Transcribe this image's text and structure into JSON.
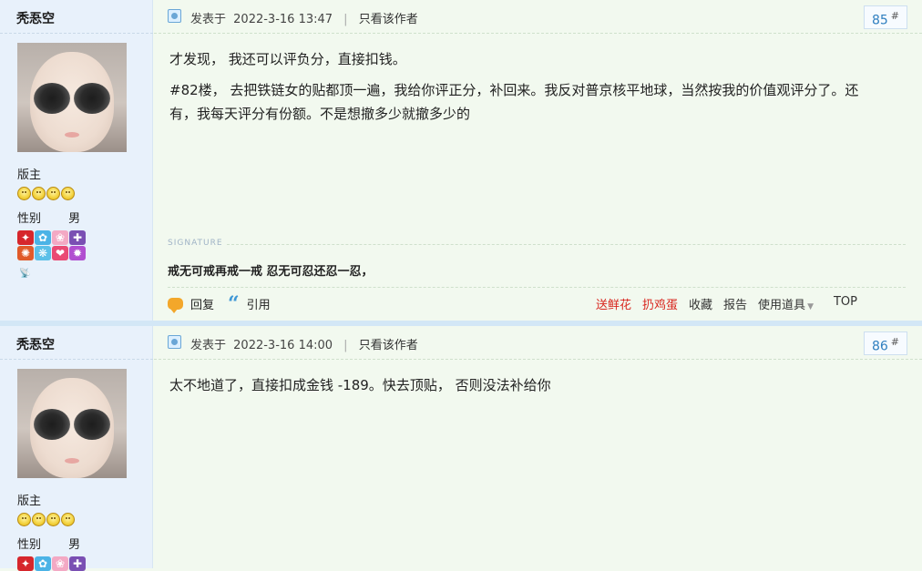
{
  "posts": [
    {
      "author": "秃忢空",
      "rank": "版主",
      "gender_label": "性别",
      "gender_value": "男",
      "posted_prefix": "发表于",
      "posted_time": "2022-3-16 13:47",
      "only_author_label": "只看该作者",
      "floor": "85",
      "floor_mark": "#",
      "content": [
        "才发现，  我还可以评负分，直接扣钱。",
        "#82楼，  去把铁链女的贴都顶一遍，我给你评正分，补回来。我反对普京核平地球，当然按我的价值观评分了。还有，我每天评分有份额。不是想撤多少就撤多少的"
      ],
      "signature_label": "SIGNATURE",
      "signature": "戒无可戒再戒一戒 忍无可忍还忍一忍，"
    },
    {
      "author": "秃忢空",
      "rank": "版主",
      "gender_label": "性别",
      "gender_value": "男",
      "posted_prefix": "发表于",
      "posted_time": "2022-3-16 14:00",
      "only_author_label": "只看该作者",
      "floor": "86",
      "floor_mark": "#",
      "content": [
        "太不地道了，直接扣成金钱 -189。快去顶贴，  否则没法补给你"
      ]
    }
  ],
  "actions": {
    "reply": "回复",
    "quote": "引用",
    "send_flower": "送鲜花",
    "throw_egg": "扔鸡蛋",
    "favorite": "收藏",
    "report": "报告",
    "use_item": "使用道具",
    "top": "TOP"
  },
  "icons": {
    "post": "post-icon",
    "reply": "speech-bubble-icon",
    "quote": "quote-icon",
    "caret": "caret-down-icon"
  },
  "colors": {
    "sidebar_bg": "#e8f1fb",
    "main_bg": "#f2f9ef",
    "link_red": "#d8251d",
    "floor_blue": "#2f7fbf"
  }
}
